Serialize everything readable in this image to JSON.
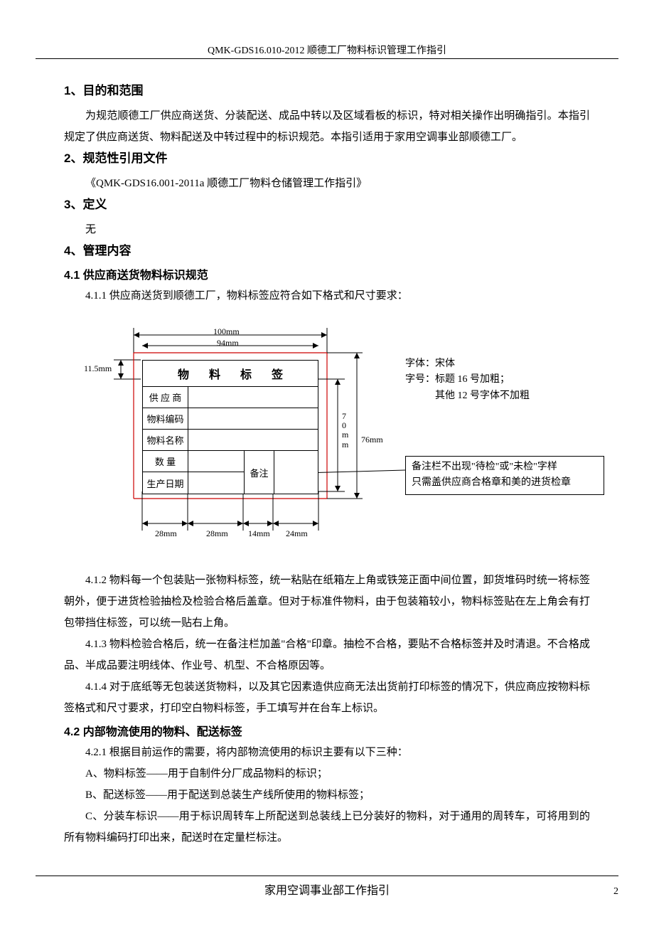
{
  "header": "QMK-GDS16.010-2012  顺德工厂物料标识管理工作指引",
  "sec1_title": "1、目的和范围",
  "sec1_p": "为规范顺德工厂供应商送货、分装配送、成品中转以及区域看板的标识，特对相关操作出明确指引。本指引规定了供应商送货、物料配送及中转过程中的标识规范。本指引适用于家用空调事业部顺德工厂。",
  "sec2_title": "2、规范性引用文件",
  "sec2_ref": "《QMK-GDS16.001-2011a  顺德工厂物料仓储管理工作指引》",
  "sec3_title": "3、定义",
  "sec3_body": "无",
  "sec4_title": "4、管理内容",
  "sec41_title": "4.1 供应商送货物料标识规范",
  "sec411": "4.1.1 供应商送货到顺德工厂，物料标签应符合如下格式和尺寸要求：",
  "diagram": {
    "dim_top1": "100mm",
    "dim_top2": "94mm",
    "dim_left": "11.5mm",
    "dim_right_inner_1": "7",
    "dim_right_inner_2": "0",
    "dim_right_inner_3": "m",
    "dim_right_inner_4": "m",
    "dim_right": "76mm",
    "dim_b1": "28mm",
    "dim_b2": "28mm",
    "dim_b3": "14mm",
    "dim_b4": "24mm",
    "label_title": "物 料 标 签",
    "row1": "供 应 商",
    "row2": "物料编码",
    "row3": "物料名称",
    "row4": "数    量",
    "row5": "生产日期",
    "remark": "备注",
    "side_font": "字体：宋体",
    "side_size_prefix": "字号：",
    "side_size1": "标题 16 号加粗；",
    "side_size2": "其他 12 号字体不加粗",
    "note_l1": "备注栏不出现\"待检\"或\"未检\"字样",
    "note_l2": "只需盖供应商合格章和美的进货检章"
  },
  "sec412": "4.1.2 物料每一个包装贴一张物料标签，统一粘贴在纸箱左上角或铁笼正面中间位置，卸货堆码时统一将标签朝外，便于进货检验抽检及检验合格后盖章。但对于标准件物料，由于包装箱较小，物料标签贴在左上角会有打包带挡住标签，可以统一贴右上角。",
  "sec413": "4.1.3 物料检验合格后，统一在备注栏加盖\"合格\"印章。抽检不合格，要贴不合格标签并及时清退。不合格成品、半成品要注明线体、作业号、机型、不合格原因等。",
  "sec414": "4.1.4 对于底纸等无包装送货物料，以及其它因素造供应商无法出货前打印标签的情况下，供应商应按物料标签格式和尺寸要求，打印空白物料标签，手工填写并在台车上标识。",
  "sec42_title": "4.2 内部物流使用的物料、配送标签",
  "sec421": "4.2.1 根据目前运作的需要，将内部物流使用的标识主要有以下三种：",
  "sec42a": "A、物料标签——用于自制件分厂成品物料的标识；",
  "sec42b": "B、配送标签——用于配送到总装生产线所使用的物料标签；",
  "sec42c": "C、分装车标识——用于标识周转车上所配送到总装线上已分装好的物料，对于通用的周转车，可将用到的所有物料编码打印出来，配送时在定量栏标注。",
  "footer_center": "家用空调事业部工作指引",
  "footer_page": "2"
}
